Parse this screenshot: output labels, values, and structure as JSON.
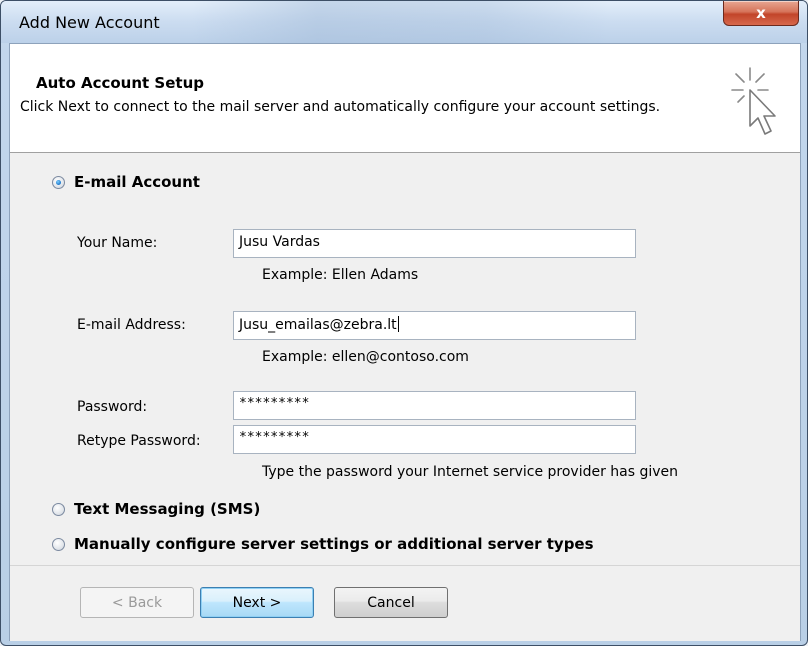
{
  "window": {
    "title": "Add New Account",
    "close_symbol": "x"
  },
  "header": {
    "title": "Auto Account Setup",
    "subtitle": "Click Next to connect to the mail server and automatically configure your account settings.",
    "icon": "cursor-sparkle-icon"
  },
  "options": {
    "email_account": {
      "label": "E-mail Account",
      "selected": true
    },
    "sms": {
      "label": "Text Messaging (SMS)",
      "selected": false
    },
    "manual": {
      "label": "Manually configure server settings or additional server types",
      "selected": false
    }
  },
  "form": {
    "name": {
      "label": "Your Name:",
      "value": "Jusu Vardas",
      "hint": "Example: Ellen Adams"
    },
    "email": {
      "label": "E-mail Address:",
      "value": "Jusu_emailas@zebra.lt",
      "hint": "Example: ellen@contoso.com"
    },
    "password": {
      "label": "Password:",
      "value": "*********"
    },
    "retype_password": {
      "label": "Retype Password:",
      "value": "*********"
    },
    "password_hint": "Type the password your Internet service provider has given"
  },
  "buttons": {
    "back": "< Back",
    "next": "Next >",
    "cancel": "Cancel"
  }
}
